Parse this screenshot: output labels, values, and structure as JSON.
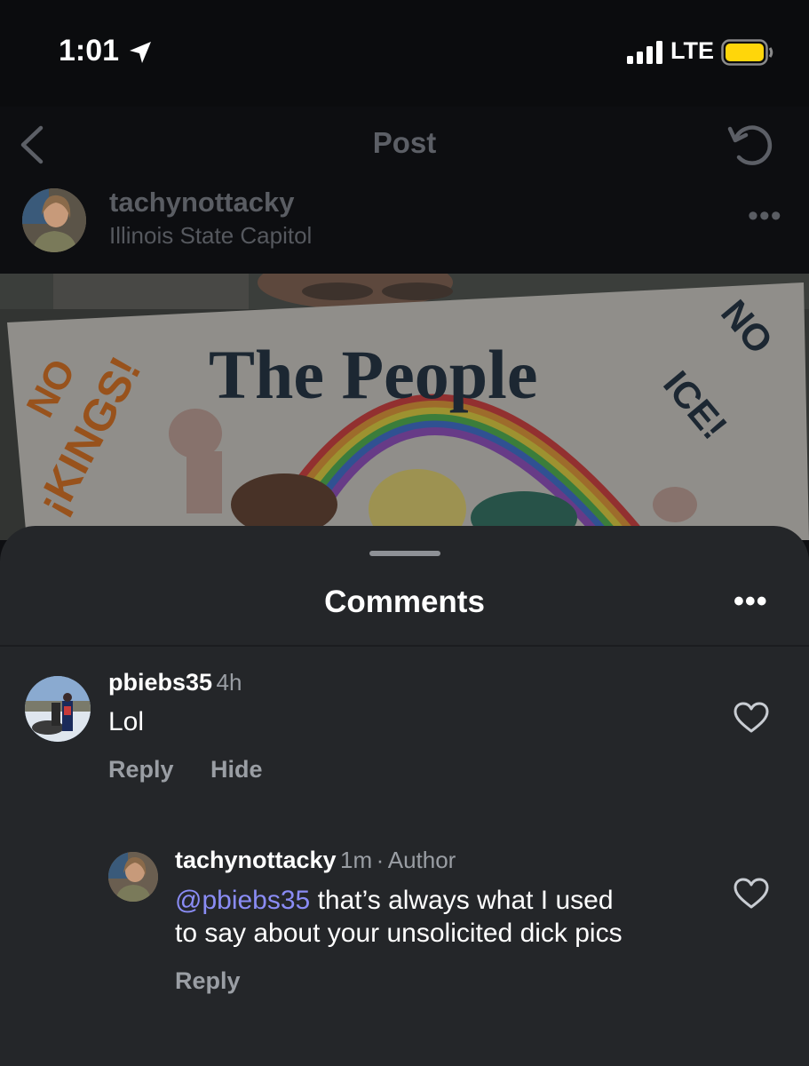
{
  "status_bar": {
    "time": "1:01",
    "network": "LTE"
  },
  "nav": {
    "title": "Post"
  },
  "post": {
    "username": "tachynottacky",
    "location": "Illinois State Capitol",
    "more": "•••"
  },
  "sign": {
    "left_text": "NO ¡KINGS!",
    "center_text": "The People",
    "right_text": "NO ICE!"
  },
  "comments_sheet": {
    "title": "Comments",
    "more": "•••",
    "comments": [
      {
        "username": "pbiebs35",
        "time": "4h",
        "text": "Lol",
        "reply_label": "Reply",
        "hide_label": "Hide"
      },
      {
        "username": "tachynottacky",
        "time": "1m",
        "badge": "Author",
        "mention": "@pbiebs35",
        "text_line1": " that’s always what I used",
        "text_line2": "to say about your unsolicited dick pics",
        "reply_label": "Reply"
      }
    ]
  },
  "icons": {
    "location": "location-arrow-icon",
    "signal": "cell-signal-icon",
    "battery": "battery-icon",
    "back": "chevron-left-icon",
    "refresh": "refresh-icon",
    "like": "heart-icon"
  },
  "colors": {
    "sheet_bg": "#242629",
    "mention": "#8a8cf5",
    "battery": "#ffd60a",
    "muted_text": "#9a9ea4"
  }
}
